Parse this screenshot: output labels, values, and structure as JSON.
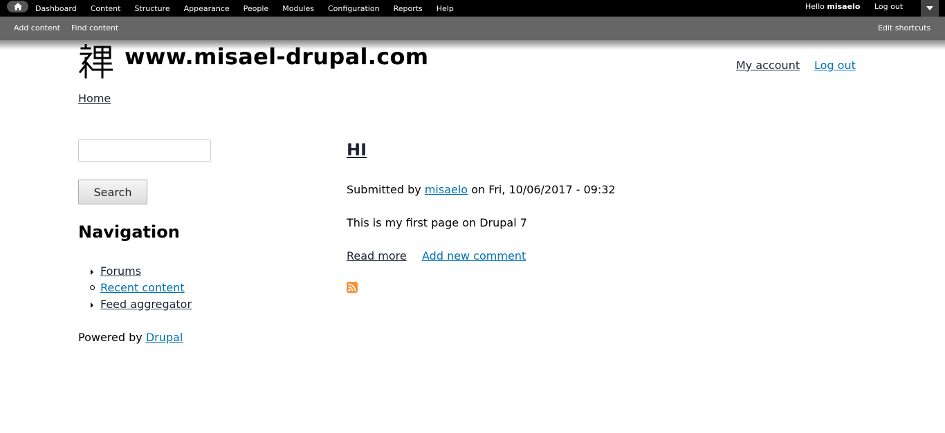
{
  "toolbar": {
    "menu": [
      "Dashboard",
      "Content",
      "Structure",
      "Appearance",
      "People",
      "Modules",
      "Configuration",
      "Reports",
      "Help"
    ],
    "hello_prefix": "Hello",
    "username": "misaelo",
    "logout": "Log out"
  },
  "shortcuts": {
    "add_content": "Add content",
    "find_content": "Find content",
    "edit_shortcuts": "Edit shortcuts"
  },
  "header": {
    "site_name": "www.misael-drupal.com",
    "my_account": "My account",
    "logout": "Log out"
  },
  "breadcrumb": {
    "home": "Home"
  },
  "sidebar": {
    "search_button": "Search",
    "navigation_title": "Navigation",
    "nav_items": [
      "Forums",
      "Recent content",
      "Feed aggregator"
    ],
    "powered_by": "Powered by",
    "drupal": "Drupal"
  },
  "node": {
    "title": "HI",
    "submitted_prefix": "Submitted by",
    "author": "misaelo",
    "submitted_date": "on Fri, 10/06/2017 - 09:32",
    "body": "This is my first page on Drupal 7",
    "read_more": "Read more",
    "add_comment": "Add new comment"
  },
  "colors": {
    "link_blue": "#0071b3",
    "link_dark": "#1a2333",
    "rss_orange": "#f39033"
  }
}
